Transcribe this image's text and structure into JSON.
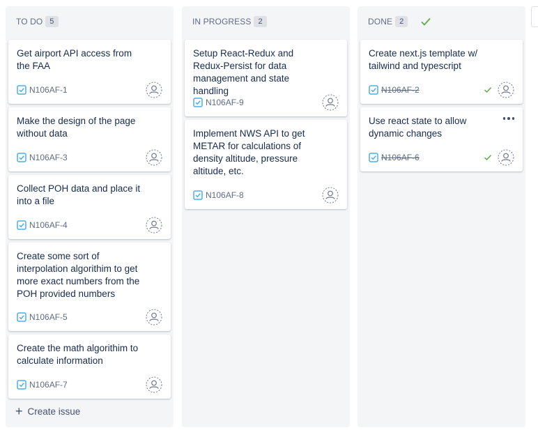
{
  "columns": {
    "todo": {
      "title": "TO DO",
      "count": "5",
      "create_label": "Create issue",
      "cards": [
        {
          "title": "Get airport API access from the FAA",
          "key": "N106AF-1"
        },
        {
          "title": "Make the design of the page without data",
          "key": "N106AF-3"
        },
        {
          "title": "Collect POH data and place it into a file",
          "key": "N106AF-4"
        },
        {
          "title": "Create some sort of interpolation algorithim to get more exact numbers from the POH provided numbers",
          "key": "N106AF-5"
        },
        {
          "title": "Create the math algorithim to calculate information",
          "key": "N106AF-7"
        }
      ]
    },
    "in_progress": {
      "title": "IN PROGRESS",
      "count": "2",
      "cards": [
        {
          "title": "Setup React-Redux and Redux-Persist for data management and state handling",
          "key": "N106AF-9"
        },
        {
          "title": "Implement NWS API to get METAR for calculations of density altitude, pressure altitude, etc.",
          "key": "N106AF-8"
        }
      ]
    },
    "done": {
      "title": "DONE",
      "count": "2",
      "cards": [
        {
          "title": "Create next.js template w/ tailwind and typescript",
          "key": "N106AF-2"
        },
        {
          "title": "Use react state to allow dynamic changes",
          "key": "N106AF-6"
        }
      ]
    }
  },
  "icons": {
    "task": "checkbox-task-icon",
    "avatar": "unassigned-avatar-icon",
    "done": "checkmark-icon",
    "more": "more-horizontal-icon",
    "create": "plus-icon"
  },
  "colors": {
    "task_icon": "#4bade8",
    "done_check": "#5aac44",
    "column_bg": "#f4f5f7"
  }
}
